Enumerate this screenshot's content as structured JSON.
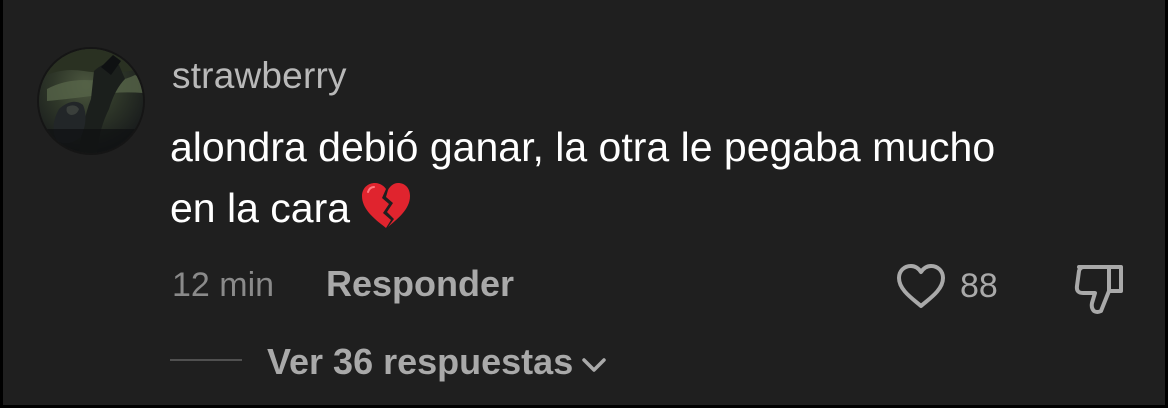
{
  "comment": {
    "username": "strawberry",
    "text_line1": "alondra debió ganar, la otra le pegaba mucho",
    "text_line2": "en la cara",
    "emoji_icon": "broken-heart-icon",
    "time": "12 min",
    "reply_label": "Responder",
    "like_count": "88",
    "like_icon": "heart-outline-icon",
    "dislike_icon": "thumbs-down-icon",
    "view_replies_label": "Ver 36 respuestas",
    "view_replies_icon": "chevron-down-icon"
  },
  "colors": {
    "background": "#1f1f1f",
    "text_primary": "#ffffff",
    "text_secondary": "#a9a9a9",
    "broken_heart": "#e0242e"
  }
}
